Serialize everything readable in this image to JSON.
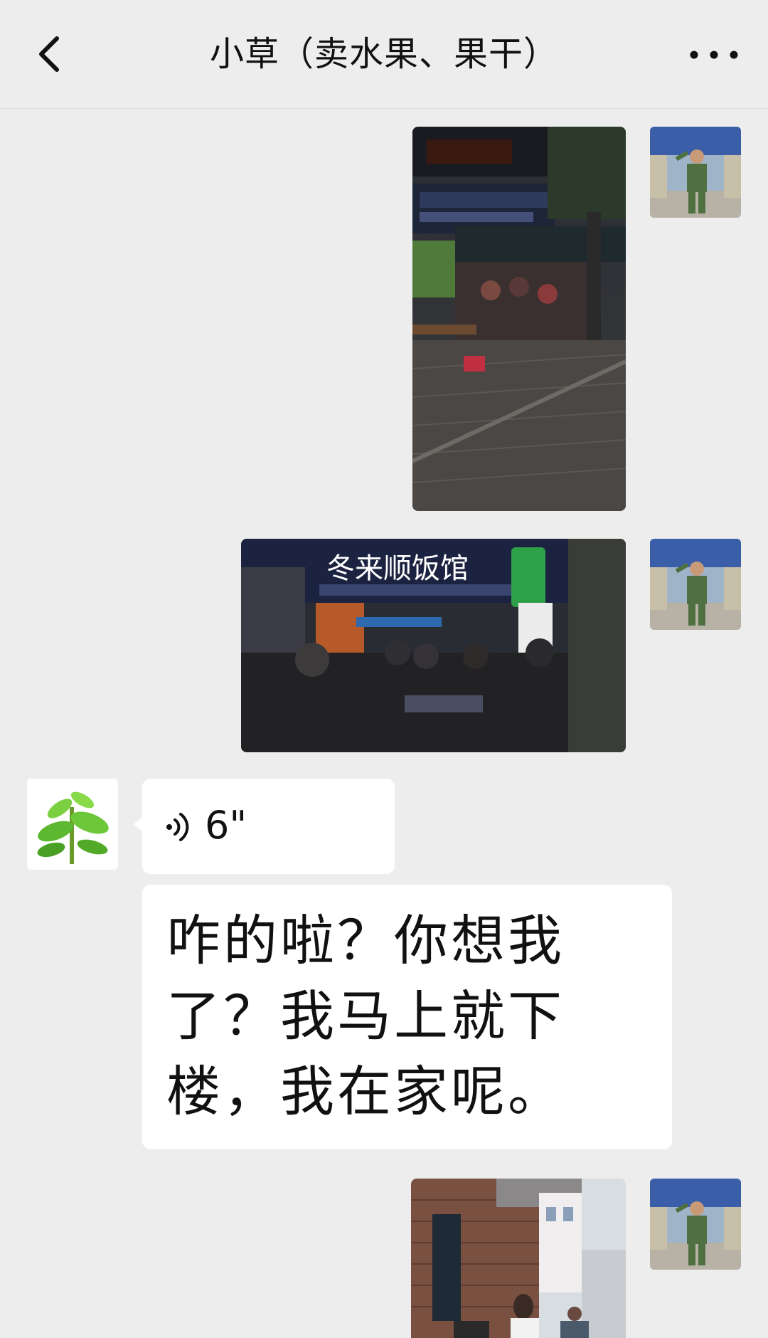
{
  "header": {
    "title": "小草（卖水果、果干）",
    "back_icon": "chevron-left-icon",
    "more_icon": "more-dots-icon"
  },
  "messages": [
    {
      "side": "right",
      "type": "image",
      "image": "restaurant-storefront-night-photo",
      "avatar": "soldier-salute-avatar"
    },
    {
      "side": "right",
      "type": "image",
      "image": "dong-lai-shun-restaurant-photo",
      "sign_text": "冬来顺饭馆",
      "avatar": "soldier-salute-avatar"
    },
    {
      "side": "left",
      "type": "voice",
      "duration": "6\"",
      "avatar": "green-sprout-avatar"
    },
    {
      "side": "left",
      "type": "text",
      "text": "咋的啦？你想我了？我马上就下楼，我在家呢。"
    },
    {
      "side": "right",
      "type": "image",
      "image": "street-building-photo",
      "avatar": "soldier-salute-avatar"
    }
  ],
  "colors": {
    "background": "#ededed",
    "bubble": "#ffffff",
    "text": "#111111"
  }
}
